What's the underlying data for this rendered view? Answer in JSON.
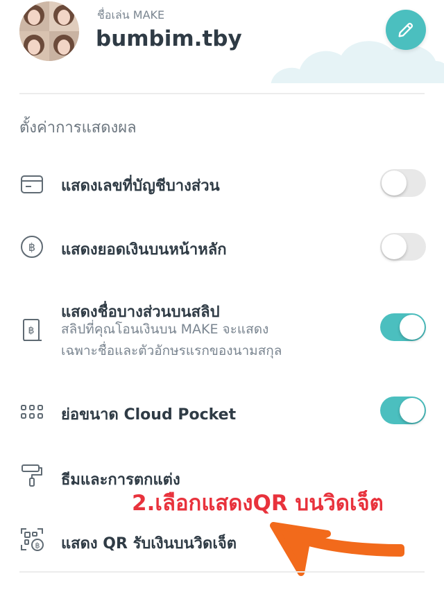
{
  "profile": {
    "nickname_label": "ชื่อเล่น MAKE",
    "username": "bumbim.tby"
  },
  "settings": {
    "section_title": "ตั้งค่าการแสดงผล",
    "items": [
      {
        "label": "แสดงเลขที่บัญชีบางส่วน",
        "icon": "card-icon",
        "enabled": false
      },
      {
        "label": "แสดงยอดเงินบนหน้าหลัก",
        "icon": "baht-coin-icon",
        "enabled": false
      },
      {
        "label": "แสดงชื่อบางส่วนบนสลิป",
        "desc_line1": "สลิปที่คุณโอนเงินบน MAKE จะแสดง",
        "desc_line2": "เฉพาะชื่อและตัวอักษรแรกของนามสกุล",
        "icon": "slip-icon",
        "enabled": true
      },
      {
        "label": "ย่อขนาด Cloud Pocket",
        "icon": "grid-icon",
        "enabled": true
      },
      {
        "label": "ธีมและการตกแต่ง",
        "icon": "paint-roller-icon"
      },
      {
        "label": "แสดง QR รับเงินบนวิดเจ็ต",
        "icon": "qr-baht-icon"
      }
    ]
  },
  "annotation": {
    "text": "2.เลือกแสดงQR บนวิดเจ็ต",
    "color": "#e8323c",
    "arrow_color": "#f26a1b"
  },
  "colors": {
    "accent": "#4bbfbf",
    "toggle_off": "#e8e8e8"
  }
}
